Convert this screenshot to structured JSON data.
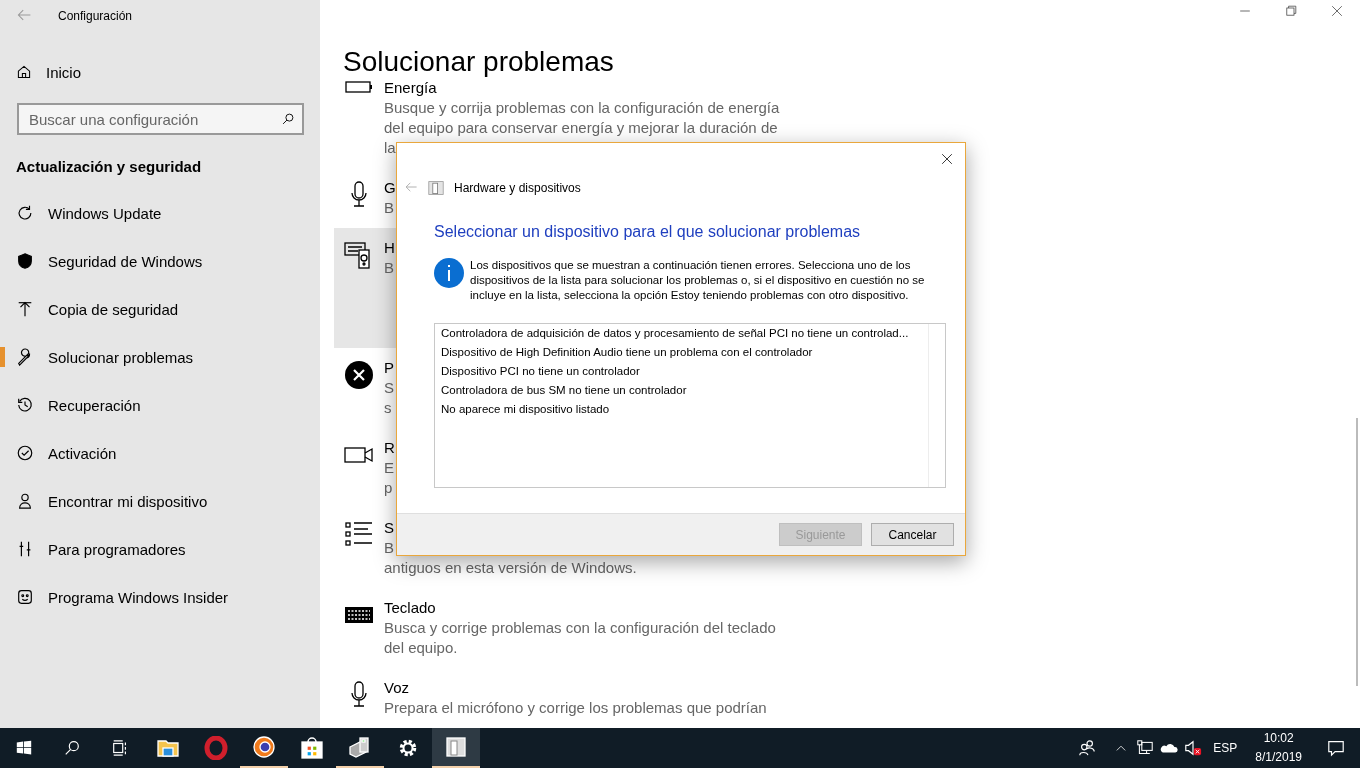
{
  "settings_window": {
    "title": "Configuración"
  },
  "sidebar": {
    "home": "Inicio",
    "search": {
      "placeholder": "Buscar una configuración"
    },
    "section_title": "Actualización y seguridad",
    "items": [
      {
        "label": "Windows Update",
        "selected": false
      },
      {
        "label": "Seguridad de Windows",
        "selected": false
      },
      {
        "label": "Copia de seguridad",
        "selected": false
      },
      {
        "label": "Solucionar problemas",
        "selected": true
      },
      {
        "label": "Recuperación",
        "selected": false
      },
      {
        "label": "Activación",
        "selected": false
      },
      {
        "label": "Encontrar mi dispositivo",
        "selected": false
      },
      {
        "label": "Para programadores",
        "selected": false
      },
      {
        "label": "Programa Windows Insider",
        "selected": false
      }
    ]
  },
  "page": {
    "title": "Solucionar problemas",
    "troubleshooters": [
      {
        "title": "Energía",
        "description_lines": [
          "Busque y corrija problemas con la configuración de energía",
          "del equipo para conservar energía y mejorar la duración de",
          "la"
        ],
        "selected": false
      },
      {
        "title": "G",
        "description_lines": [
          "B"
        ],
        "selected": false
      },
      {
        "title": "H",
        "description_lines": [
          "B"
        ],
        "selected": true
      },
      {
        "title": "P",
        "description_lines": [
          "S",
          "s"
        ],
        "selected": false
      },
      {
        "title": "R",
        "description_lines": [
          "E",
          "p"
        ],
        "selected": false
      },
      {
        "title": "S",
        "description_lines": [
          "B",
          "antiguos en esta versión de Windows."
        ],
        "selected": false
      },
      {
        "title": "Teclado",
        "description_lines": [
          "Busca y corrige problemas con la configuración del teclado",
          "del equipo."
        ],
        "selected": false
      },
      {
        "title": "Voz",
        "description_lines": [
          "Prepara el micrófono y corrige los problemas que podrían"
        ],
        "selected": false
      }
    ]
  },
  "dialog": {
    "header_title": "Hardware y dispositivos",
    "heading": "Seleccionar un dispositivo para el que solucionar problemas",
    "info": "Los dispositivos que se muestran a continuación tienen errores. Selecciona uno de los dispositivos de la lista para solucionar los problemas o, si el dispositivo en cuestión no se incluye en la lista, selecciona la opción Estoy teniendo problemas con otro dispositivo.",
    "devices": [
      "Controladora de adquisición de datos y procesamiento de señal PCI no tiene un controlad...",
      "Dispositivo de High Definition Audio tiene un problema con el controlador",
      "Dispositivo PCI no tiene un controlador",
      "Controladora de bus SM no tiene un controlador",
      "No aparece mi dispositivo listado"
    ],
    "buttons": [
      {
        "label": "Siguiente",
        "disabled": true
      },
      {
        "label": "Cancelar",
        "disabled": false
      }
    ]
  },
  "taskbar": {
    "apps": [
      {
        "running": false,
        "active": false
      },
      {
        "running": false,
        "active": false
      },
      {
        "running": true,
        "active": false
      },
      {
        "running": false,
        "active": false
      },
      {
        "running": true,
        "active": false
      },
      {
        "running": false,
        "active": false
      },
      {
        "running": true,
        "active": true
      }
    ],
    "language": "ESP",
    "time": "10:02",
    "date": "8/1/2019"
  }
}
